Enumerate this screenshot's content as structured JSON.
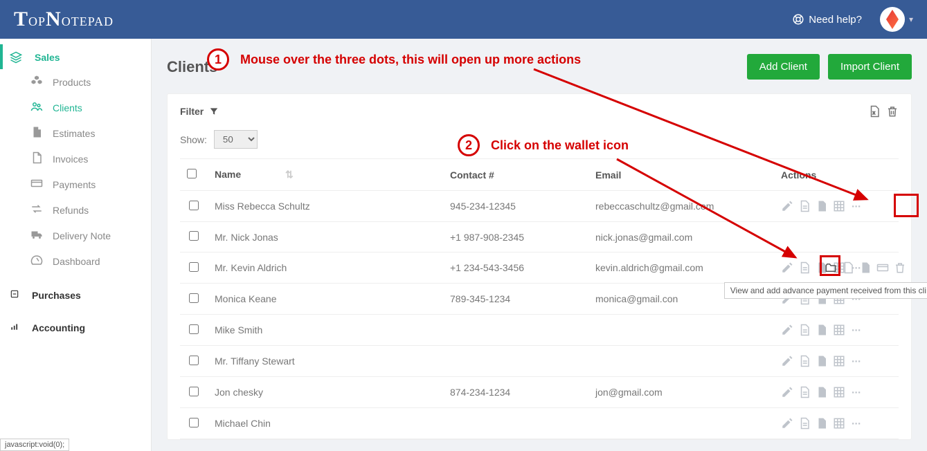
{
  "header": {
    "logo": "TopNotepad",
    "help_label": "Need help?"
  },
  "sidebar": {
    "sales_label": "Sales",
    "items": [
      {
        "label": "Products"
      },
      {
        "label": "Clients"
      },
      {
        "label": "Estimates"
      },
      {
        "label": "Invoices"
      },
      {
        "label": "Payments"
      },
      {
        "label": "Refunds"
      },
      {
        "label": "Delivery Note"
      },
      {
        "label": "Dashboard"
      }
    ],
    "purchases_label": "Purchases",
    "accounting_label": "Accounting"
  },
  "page": {
    "title": "Clients",
    "add_client": "Add Client",
    "import_client": "Import Client",
    "filter_label": "Filter",
    "show_label": "Show:",
    "show_value": "50",
    "columns": {
      "name": "Name",
      "contact": "Contact #",
      "email": "Email",
      "actions": "Actions"
    },
    "rows": [
      {
        "name": "Miss Rebecca Schultz",
        "contact": "945-234-12345",
        "email": "rebeccaschultz@gmail.com"
      },
      {
        "name": "Mr. Nick Jonas",
        "contact": "+1 987-908-2345",
        "email": "nick.jonas@gmail.com"
      },
      {
        "name": "Mr. Kevin Aldrich",
        "contact": "+1 234-543-3456",
        "email": "kevin.aldrich@gmail.com"
      },
      {
        "name": "Monica Keane",
        "contact": "789-345-1234",
        "email": "monica@gmail.con"
      },
      {
        "name": "Mike Smith",
        "contact": "",
        "email": ""
      },
      {
        "name": "Mr. Tiffany Stewart",
        "contact": "",
        "email": ""
      },
      {
        "name": "Jon chesky",
        "contact": "874-234-1234",
        "email": "jon@gmail.com"
      },
      {
        "name": "Michael Chin",
        "contact": "",
        "email": ""
      }
    ],
    "tooltip": "View and add advance payment received from this cli"
  },
  "annotations": {
    "step1": "Mouse over the three dots, this will open up more actions",
    "step2": "Click on the wallet icon",
    "n1": "1",
    "n2": "2"
  },
  "status_bar": "javascript:void(0);"
}
